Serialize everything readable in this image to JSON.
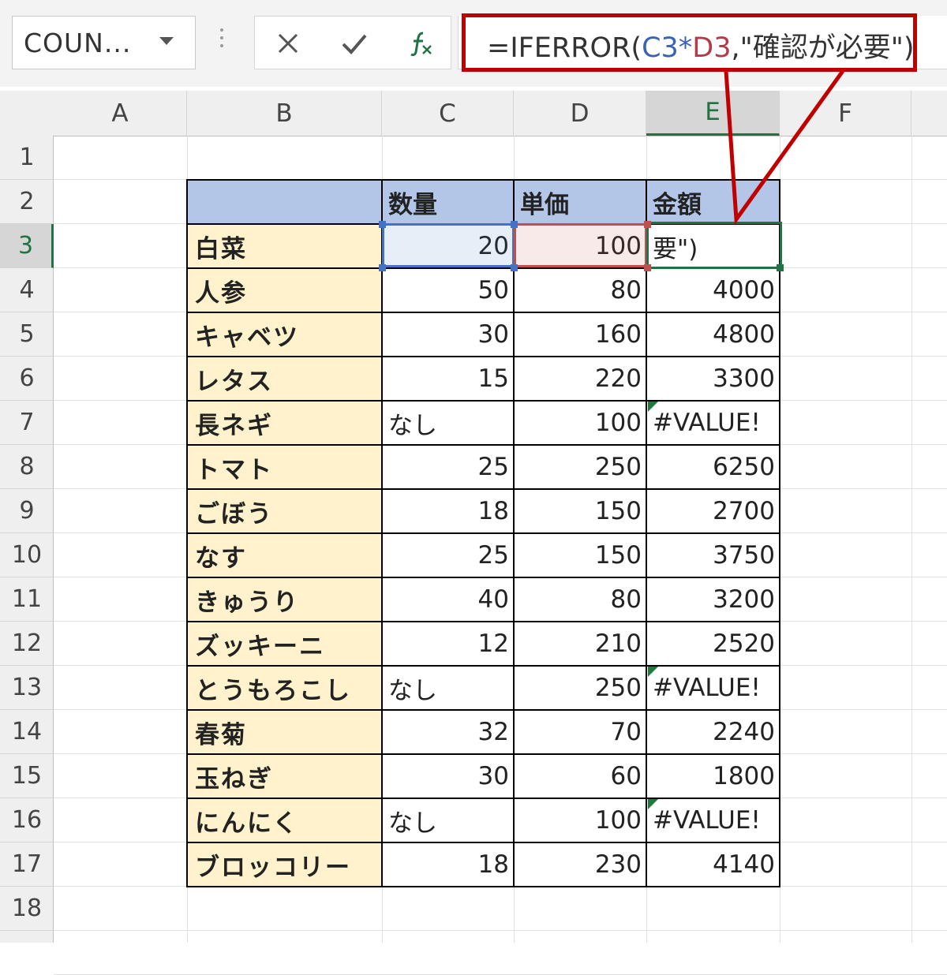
{
  "name_box": {
    "value": "COUN..."
  },
  "formula_bar": {
    "parts": [
      {
        "text": "=IFERROR(",
        "kind": "plain"
      },
      {
        "text": "C3",
        "kind": "ref-c"
      },
      {
        "text": "*",
        "kind": "plain"
      },
      {
        "text": "D3",
        "kind": "ref-d"
      },
      {
        "text": ",\"確認が必要\")",
        "kind": "plain"
      }
    ],
    "cancel_icon": "close-icon",
    "enter_icon": "check-icon",
    "fx_icon": "function-icon"
  },
  "columns": [
    "A",
    "B",
    "C",
    "D",
    "E",
    "F"
  ],
  "active_column": "E",
  "rows": [
    "1",
    "2",
    "3",
    "4",
    "5",
    "6",
    "7",
    "8",
    "9",
    "10",
    "11",
    "12",
    "13",
    "14",
    "15",
    "16",
    "17",
    "18"
  ],
  "active_row": "3",
  "table": {
    "headers": [
      "",
      "数量",
      "単価",
      "金額"
    ],
    "rows": [
      {
        "name": "白菜",
        "qty": "20",
        "price": "100",
        "amount": "要\")"
      },
      {
        "name": "人参",
        "qty": "50",
        "price": "80",
        "amount": "4000"
      },
      {
        "name": "キャベツ",
        "qty": "30",
        "price": "160",
        "amount": "4800"
      },
      {
        "name": "レタス",
        "qty": "15",
        "price": "220",
        "amount": "3300"
      },
      {
        "name": "長ネギ",
        "qty": "なし",
        "price": "100",
        "amount": "#VALUE!"
      },
      {
        "name": "トマト",
        "qty": "25",
        "price": "250",
        "amount": "6250"
      },
      {
        "name": "ごぼう",
        "qty": "18",
        "price": "150",
        "amount": "2700"
      },
      {
        "name": "なす",
        "qty": "25",
        "price": "150",
        "amount": "3750"
      },
      {
        "name": "きゅうり",
        "qty": "40",
        "price": "80",
        "amount": "3200"
      },
      {
        "name": "ズッキーニ",
        "qty": "12",
        "price": "210",
        "amount": "2520"
      },
      {
        "name": "とうもろこし",
        "qty": "なし",
        "price": "250",
        "amount": "#VALUE!"
      },
      {
        "name": "春菊",
        "qty": "32",
        "price": "70",
        "amount": "2240"
      },
      {
        "name": "玉ねぎ",
        "qty": "30",
        "price": "60",
        "amount": "1800"
      },
      {
        "name": "にんにく",
        "qty": "なし",
        "price": "100",
        "amount": "#VALUE!"
      },
      {
        "name": "ブロッコリー",
        "qty": "18",
        "price": "230",
        "amount": "4140"
      }
    ]
  },
  "colors": {
    "header_fill": "#b4c6e7",
    "name_fill": "#fff2cc",
    "callout": "#c00000",
    "excel_green": "#217346"
  }
}
